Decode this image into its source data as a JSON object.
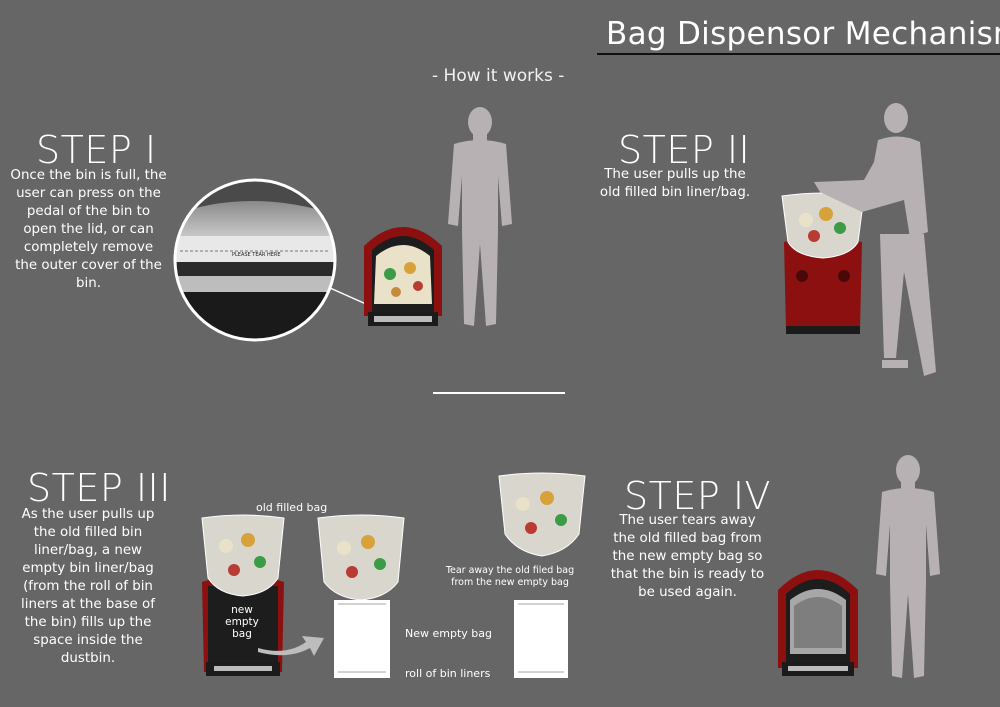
{
  "header": {
    "title": "Bag Dispensor Mechanism",
    "subtitle": "- How it works -"
  },
  "steps": [
    {
      "heading": "STEP I",
      "lines": [
        "Once the bin is full, the",
        "user can press on the",
        "pedal of the bin to",
        "open the lid, or can",
        "completely remove",
        "the outer cover of the",
        "bin."
      ],
      "inset_label": "PLEASE TEAR HERE"
    },
    {
      "heading": "STEP II",
      "lines": [
        "The user pulls up the",
        "old filled bin liner/bag."
      ]
    },
    {
      "heading": "STEP III",
      "lines": [
        "As the user pulls up",
        "the old filled bin",
        "liner/bag, a new",
        "empty bin liner/bag",
        "(from the  roll of bin",
        "liners at the base of",
        "the bin) fills up the",
        "space inside the",
        "dustbin."
      ]
    },
    {
      "heading": "STEP IV",
      "lines": [
        "The user tears away",
        "the old filled bag from",
        "the new empty bag so",
        "that the bin is ready to",
        "be used again."
      ]
    }
  ],
  "labels": {
    "old_filled_bag": "old filled bag",
    "new_empty_bag_in_bin": [
      "new",
      "empty",
      "bag"
    ],
    "tear_away": [
      "Tear away the old filed bag",
      "from the new empty bag"
    ],
    "new_empty_bag": "New empty bag",
    "roll_of_bin_liners": "roll of bin liners"
  },
  "colors": {
    "background": "#666666",
    "text": "#ffffff",
    "title_rule": "#111111",
    "silhouette": "#b7b1b3",
    "bin_red": "#8c1010",
    "bin_black": "#1c1c1c",
    "bag_white": "#ffffff"
  }
}
